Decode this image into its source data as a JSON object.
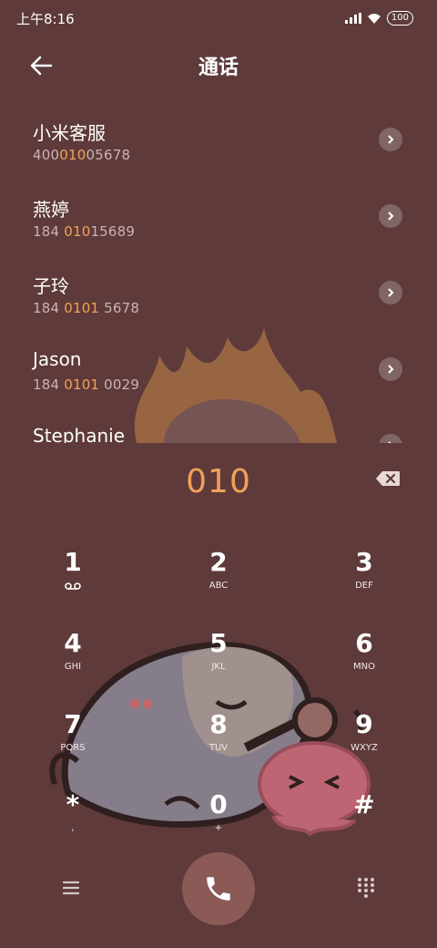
{
  "status_bar": {
    "time": "上午8:16",
    "battery": "100"
  },
  "header": {
    "title": "通话"
  },
  "contacts": [
    {
      "name": "小米客服",
      "number_pre": "400",
      "number_match": "010",
      "number_post": "05678"
    },
    {
      "name": "燕婷",
      "number_pre": "184 ",
      "number_match": "010",
      "number_post": "15689"
    },
    {
      "name": "子玲",
      "number_pre": "184 ",
      "number_match": "0101",
      "number_post": " 5678"
    },
    {
      "name": "Jason",
      "number_pre": "184 ",
      "number_match": "0101",
      "number_post": " 0029"
    },
    {
      "name": "Stephanie",
      "number_pre": "",
      "number_match": "",
      "number_post": ""
    }
  ],
  "dialer": {
    "entered_number": "010"
  },
  "keypad": [
    {
      "digit": "1",
      "letters": ""
    },
    {
      "digit": "2",
      "letters": "ABC"
    },
    {
      "digit": "3",
      "letters": "DEF"
    },
    {
      "digit": "4",
      "letters": "GHI"
    },
    {
      "digit": "5",
      "letters": "JKL"
    },
    {
      "digit": "6",
      "letters": "MNO"
    },
    {
      "digit": "7",
      "letters": "PQRS"
    },
    {
      "digit": "8",
      "letters": "TUV"
    },
    {
      "digit": "9",
      "letters": "WXYZ"
    },
    {
      "digit": "*",
      "letters": ","
    },
    {
      "digit": "0",
      "letters": "+"
    },
    {
      "digit": "#",
      "letters": ""
    }
  ],
  "icons": {
    "back": "arrow-left-icon",
    "detail": "chevron-right-icon",
    "backspace": "backspace-icon",
    "voicemail": "voicemail-icon",
    "menu": "menu-icon",
    "call": "phone-icon",
    "keypad_toggle": "dialpad-icon"
  },
  "colors": {
    "background": "#5e3a3a",
    "highlight": "#f0a25a",
    "call_button": "#8b5a56"
  }
}
